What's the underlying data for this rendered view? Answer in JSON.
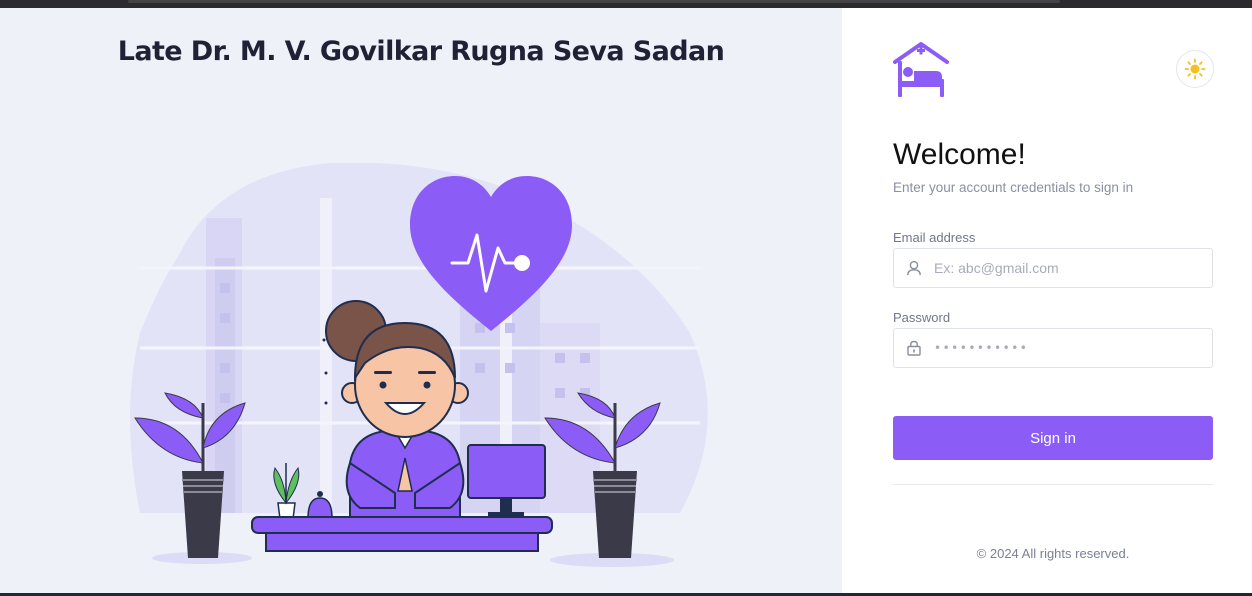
{
  "page": {
    "hospital_name": "Late Dr. M. V. Govilkar Rugna Seva Sadan"
  },
  "brand": {
    "logo_icon": "hospital-bed-icon",
    "accent_color": "#8b5cf6"
  },
  "theme_toggle": {
    "icon": "sun-icon"
  },
  "login": {
    "heading": "Welcome!",
    "subtitle": "Enter your account credentials to sign in",
    "email_label": "Email address",
    "email_placeholder": "Ex: abc@gmail.com",
    "password_label": "Password",
    "password_mask": "•••••••••••",
    "submit_label": "Sign in"
  },
  "footer": {
    "copyright": "© 2024 All rights reserved."
  }
}
